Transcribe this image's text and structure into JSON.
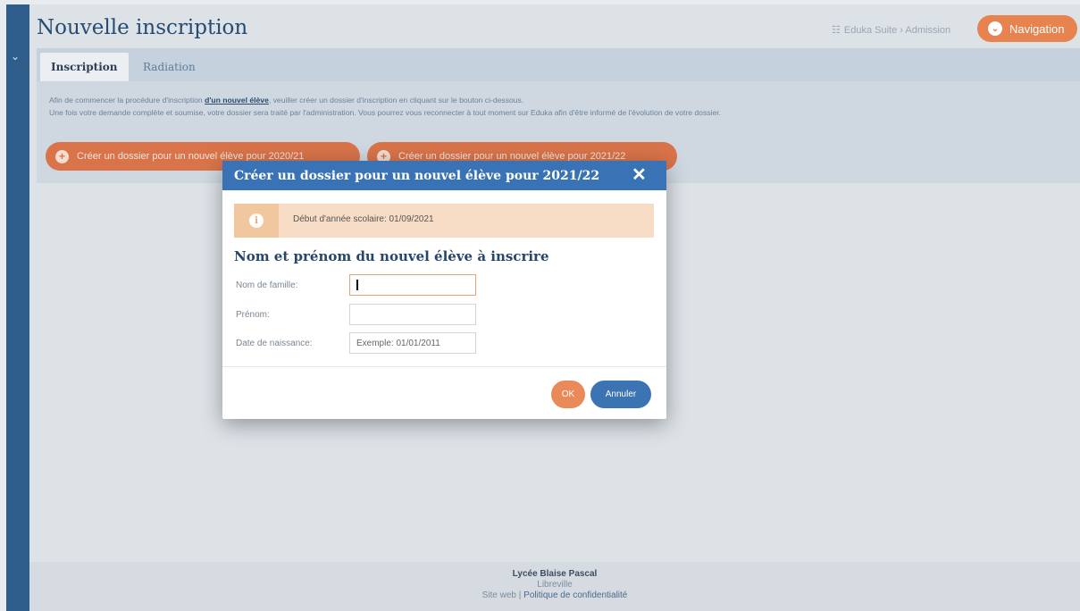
{
  "header": {
    "title": "Nouvelle inscription",
    "breadcrumb": "Eduka Suite › Admission",
    "breadcrumb_icon": "sitemap-icon",
    "nav_button_label": "Navigation",
    "nav_button_icon": "chevron-circle-icon"
  },
  "sidebar": {
    "toggle_icon": "chevron-down-icon"
  },
  "tabs": [
    {
      "label": "Inscription",
      "active": true
    },
    {
      "label": "Radiation",
      "active": false
    }
  ],
  "intro": {
    "line1_before": "Afin de commencer la procédure d'inscription ",
    "line1_link": "d'un nouvel élève",
    "line1_after": ", veuiller créer un dossier d'inscription en cliquant sur le bouton ci-dessous.",
    "line2": "Une fois votre demande complète et soumise, votre dossier sera traité par l'administration. Vous pourrez vous reconnecter à tout moment sur Eduka afin d'être informé de l'évolution de votre dossier."
  },
  "actions": {
    "create_2020": "Créer un dossier pour un nouvel élève pour 2020/21",
    "create_2021": "Créer un dossier pour un nouvel élève pour 2021/22"
  },
  "modal": {
    "title": "Créer un dossier pour un nouvel élève pour 2021/22",
    "close_icon": "close-icon",
    "alert_text": "Début d'année scolaire: 01/09/2021",
    "alert_icon": "info-icon",
    "section_title": "Nom et prénom du nouvel élève à inscrire",
    "fields": {
      "lastname_label": "Nom de famille:",
      "lastname_value": "",
      "firstname_label": "Prénom:",
      "firstname_value": "",
      "birthdate_label": "Date de naissance:",
      "birthdate_placeholder": "Exemple: 01/01/2011"
    },
    "ok_label": "OK",
    "cancel_label": "Annuler"
  },
  "footer": {
    "school": "Lycée Blaise Pascal",
    "city": "Libreville",
    "link_site": "Site web",
    "separator": " | ",
    "link_privacy": "Politique de confidentialité"
  },
  "colors": {
    "primary_blue": "#3973b5",
    "accent_orange": "#e6834f",
    "alert_bg": "#f7ddc6"
  }
}
